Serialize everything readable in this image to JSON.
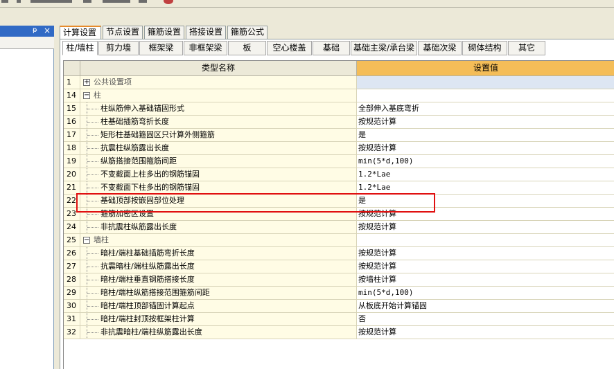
{
  "tabs": [
    "计算设置",
    "节点设置",
    "箍筋设置",
    "搭接设置",
    "箍筋公式"
  ],
  "subtabs": [
    "柱/墙柱",
    "剪力墙",
    "框架梁",
    "非框架梁",
    "板",
    "空心楼盖",
    "基础",
    "基础主梁/承台梁",
    "基础次梁",
    "砌体结构",
    "其它"
  ],
  "left_panel": {
    "pin": "ᵽ",
    "close": "×"
  },
  "grid": {
    "col_name": "类型名称",
    "col_value": "设置值",
    "rows": [
      {
        "num": "1",
        "type": "group",
        "expander": "+",
        "name": "公共设置项",
        "value": ""
      },
      {
        "num": "14",
        "type": "group",
        "expander": "−",
        "name": "柱",
        "value": ""
      },
      {
        "num": "15",
        "type": "item",
        "name": "柱纵筋伸入基础锚固形式",
        "value": "全部伸入基底弯折"
      },
      {
        "num": "16",
        "type": "item",
        "name": "柱基础插筋弯折长度",
        "value": "按规范计算"
      },
      {
        "num": "17",
        "type": "item",
        "name": "矩形柱基础箍固区只计算外侧箍筋",
        "value": "是"
      },
      {
        "num": "18",
        "type": "item",
        "name": "抗震柱纵筋露出长度",
        "value": "按规范计算"
      },
      {
        "num": "19",
        "type": "item",
        "name": "纵筋搭接范围箍筋间距",
        "value": "min(5*d,100)"
      },
      {
        "num": "20",
        "type": "item",
        "name": "不变截面上柱多出的钢筋锚固",
        "value": "1.2*Lae"
      },
      {
        "num": "21",
        "type": "item",
        "name": "不变截面下柱多出的钢筋锚固",
        "value": "1.2*Lae"
      },
      {
        "num": "22",
        "type": "item",
        "name": "基础顶部按嵌固部位处理",
        "value": "是"
      },
      {
        "num": "23",
        "type": "item",
        "name": "箍筋加密区设置",
        "value": "按规范计算"
      },
      {
        "num": "24",
        "type": "item",
        "name": "非抗震柱纵筋露出长度",
        "value": "按规范计算"
      },
      {
        "num": "25",
        "type": "group",
        "expander": "−",
        "name": "墙柱",
        "value": ""
      },
      {
        "num": "26",
        "type": "item",
        "name": "暗柱/端柱基础插筋弯折长度",
        "value": "按规范计算"
      },
      {
        "num": "27",
        "type": "item",
        "name": "抗震暗柱/端柱纵筋露出长度",
        "value": "按规范计算"
      },
      {
        "num": "28",
        "type": "item",
        "name": "暗柱/端柱垂直钢筋搭接长度",
        "value": "按墙柱计算"
      },
      {
        "num": "29",
        "type": "item",
        "name": "暗柱/端柱纵筋搭接范围箍筋间距",
        "value": "min(5*d,100)"
      },
      {
        "num": "30",
        "type": "item",
        "name": "暗柱/端柱顶部锚固计算起点",
        "value": "从板底开始计算锚固"
      },
      {
        "num": "31",
        "type": "item",
        "name": "暗柱/端柱封顶按框架柱计算",
        "value": "否"
      },
      {
        "num": "32",
        "type": "item",
        "name": "非抗震暗柱/端柱纵筋露出长度",
        "value": "按规范计算"
      }
    ]
  },
  "colors": {
    "header_value": "#f4bd58",
    "row_bg": "#fffce5",
    "highlight": "#e01010",
    "title_bar": "#316ac5"
  }
}
